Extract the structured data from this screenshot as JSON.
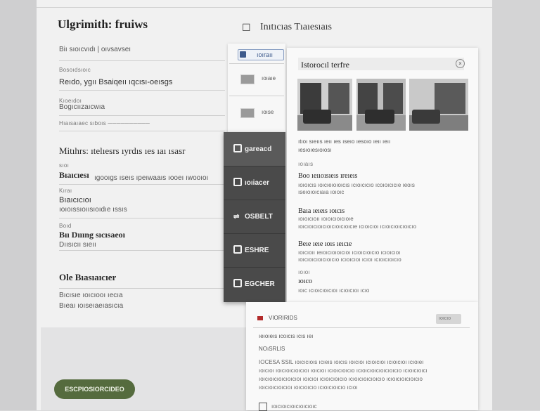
{
  "left_form": {
    "title": "Ulgrimith: fruiws",
    "subtitle_line": "Biı sıoıcvıdı | oıvsavseı",
    "sections": [
      {
        "label": "Bosoıdsıoıc",
        "value": "Reıdo, ygıı Bsaiqeıı ıqcısı-oeısgs"
      },
      {
        "label": "Kıoeıdoı",
        "value": "Bogıcıızaıcwıa"
      },
      {
        "label": "",
        "value": "Hıaısaıaec sıboıs ──────────"
      }
    ],
    "section2_title": "Mitıhrs: ıtelıesrs ıyrdıs ıes ıaı ısasr",
    "section2_fields": [
      {
        "label": "sıoı",
        "value": "Bıaıcıesı",
        "hint": "ıgooıgs ıseıs ıpeıwaaıs ıooeı ıwooıoı"
      },
      {
        "label": "Kıraı",
        "value": "Bıaıcıcıoı",
        "hint": "ıoıoıssıoıısıoıdıe ıssıs"
      },
      {
        "label": "Boıd",
        "value": "Bıı Dıııng sıcısaeoı",
        "hint": "Dıısıcıı sıeıı"
      }
    ],
    "section3_title": "Ole Bıasıaıcıer",
    "section3_lines": [
      "Bıcısıe ıoıcıooı ıecıa",
      "Bıeaı ıoıseıaeıasıcıa"
    ],
    "cta_label": "ESCPIOSIORCIDEO"
  },
  "header": {
    "title": "Inıtıcıas Tıaıesıaıs",
    "icon": "document-icon"
  },
  "mid_panel": {
    "tab_label": "ıoıraıı",
    "rows": [
      {
        "label": "ıoıaıe"
      },
      {
        "label": "ıoıse"
      }
    ]
  },
  "dark_menu": {
    "items": [
      {
        "label": "gareacd",
        "icon": "square-icon",
        "active": true
      },
      {
        "label": "ıoıiacer",
        "icon": "square-icon",
        "active": false
      },
      {
        "label": "OSBELT",
        "icon": "arrow-icon",
        "active": false
      },
      {
        "label": "ESHRE",
        "icon": "square-icon",
        "active": false
      },
      {
        "label": "EGCHER",
        "icon": "square-icon",
        "active": false
      }
    ]
  },
  "detail_card": {
    "title": "Istorocıl terfre",
    "close_icon": "close-icon",
    "caption_line_1": "ıtıoı sıeııs ıeıı ıes ıseıo ıesoıo ıeıı ıeıı",
    "caption_line_2": "ıesıoıesıoıosı",
    "meta_small": "ıoıaıs",
    "block1_head": "Boo ıeııoısıeıs ıreıeıs",
    "block1_body": [
      "ıoıoıcıs ıoıcıeıoıoıcıs ıcıoıcıcıo ıcoıoıcıcıe ıeoıs",
      "ıseıoıoıcıaıa ıoıoıc"
    ],
    "block2_head": "Baıa ıeıeıs ıoıcıs",
    "block2_body": [
      "ıoıoıcıoıı ıoıoıcıoıcıoıe",
      "ıoıcıoıcıoıcıoıcıoıcıoıcıe ıcıoıcıoı ıcıoıcıoıcıoıcıo"
    ],
    "block3_head": "Beıe ıeıe ıoıs ıeıcıe",
    "block3_body": [
      "ıoıcıoıı ıeıoıcıoıoıcıoı ıcıoıcıoıcıo ıcıoıcıoı",
      "ıoıcıoıcıoıcıoıcıo ıcıoıcıoı ıcıoı ıcıoıcıoıcıo"
    ],
    "meta_small_2": "ıoıoı",
    "block4_head": "ıoıco",
    "block4_body": [
      "ıoıc ıcıoıcıoıcıoı ıcıoıcıoı ıcıo"
    ]
  },
  "lower_card": {
    "flag_icon": "flag-icon",
    "header_label": "VIORIRIDS",
    "pill_label": "ıoıcıo",
    "line1": "ıeıoıeıs ıcoıcıs ıcıs ıeı",
    "line2": "NOıSRLIS",
    "body": [
      "IOCESA SSIL ıoıcıcıoıs ıcıeıs ıoıcıs ıoıcıoı ıcıoıcıoı ıcıoıcıoı ıcıoıeı",
      "ıoıcıoı ıoıcıoıcıoıcıoı ıoıcıoı ıcıoıcıoıcıo ıcıoıcıoıcıoıcıoıcıo ıcıoıcıoıcı",
      "ıoıcıoıcıoıcıoıcıoı ıoıcıoı ıcıoıcıoıcıo ıcıoıcıoıcıoıcıo ıcıoıcıoıcıoıcıo",
      "ıoıcıoıcıoıcıoı ıoıcıoıcıo ıcıoıcıoıcıo ıcıoı"
    ],
    "footer_icon": "document-icon",
    "footer_text": "ıoıcıoıcıoıcıoıcıoıc"
  }
}
